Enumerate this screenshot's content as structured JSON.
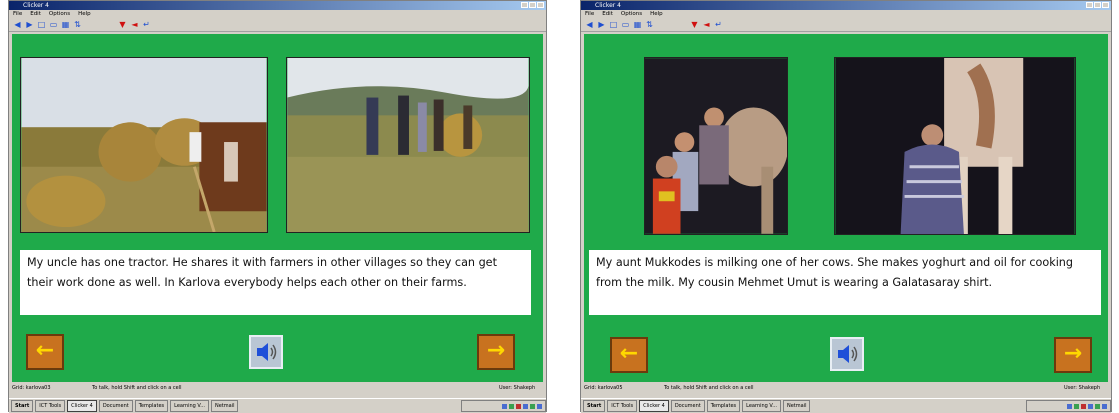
{
  "windows": [
    {
      "title": "Clicker 4",
      "menu": [
        "File",
        "Edit",
        "Options",
        "Help"
      ],
      "caption": "My uncle has one tractor. He shares it with farmers in other villages so they can get their work done as well. In Karlova everybody helps each other on their farms.",
      "status": {
        "left": "Grid: karlova03",
        "middle": "To talk, hold Shift and click on a cell",
        "right": "User: Shakeph"
      },
      "taskbar": [
        "Start",
        "ICT Tools",
        "Clicker 4",
        "Document",
        "Templates",
        "Learning V...",
        "Netmail"
      ]
    },
    {
      "title": "Clicker 4",
      "menu": [
        "File",
        "Edit",
        "Options",
        "Help"
      ],
      "caption": "My aunt Mukkodes is milking one of her cows. She makes yoghurt and oil for cooking from the milk. My cousin Mehmet Umut is wearing a Galatasaray shirt.",
      "status": {
        "left": "Grid: karlova05",
        "middle": "To talk, hold Shift and click on a cell",
        "right": "User: Shakeph"
      },
      "taskbar": [
        "Start",
        "ICT Tools",
        "Clicker 4",
        "Document",
        "Templates",
        "Learning V...",
        "Netmail"
      ]
    }
  ],
  "nav": {
    "prev_glyph": "←",
    "next_glyph": "→"
  },
  "colors": {
    "background": "#1faa4a",
    "nav_button": "#c8721f",
    "arrow": "#ffd800"
  }
}
